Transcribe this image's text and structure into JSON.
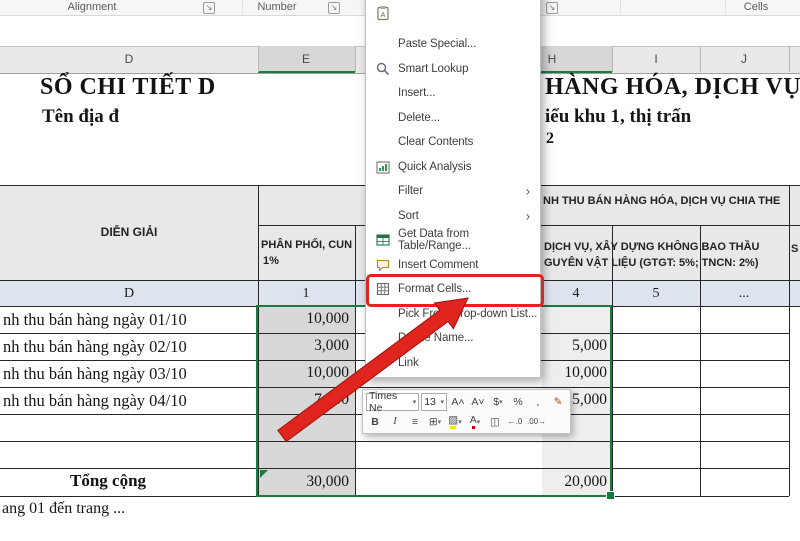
{
  "ribbon": {
    "groups": [
      "Alignment",
      "Number",
      "Cells"
    ],
    "launcher_glyph": "↘"
  },
  "columns": {
    "list": [
      "D",
      "E",
      "H",
      "I",
      "J"
    ]
  },
  "titles": {
    "line1_left": "SỔ CHI TIẾT D",
    "line1_right": "HÀNG HÓA, DỊCH VỤ",
    "line2_left": "Tên địa đ",
    "line2_right": "iểu khu 1, thị trấn",
    "fragment": "2"
  },
  "table": {
    "dien_giai": "DIỄN GIẢI",
    "span_header": "NH THU BÁN HÀNG HÓA, DỊCH VỤ CHIA THE",
    "col_e_line1": "PHÂN PHỐI, CUN",
    "col_e_line2": "1%",
    "col_h_line1": "DỊCH VỤ, XÂY DỰNG KHÔNG BAO THẦU",
    "col_h_line2": "GUYÊN VẬT LIỆU (GTGT: 5%; TNCN: 2%)",
    "right_fragment": "S",
    "number_row": [
      "D",
      "1",
      "4",
      "5",
      "..."
    ],
    "rows": [
      {
        "label": "nh thu bán hàng ngày 01/10",
        "e": "10,000",
        "h": ""
      },
      {
        "label": "nh thu bán hàng ngày 02/10",
        "e": "3,000",
        "h": "5,000"
      },
      {
        "label": "nh thu bán hàng ngày 03/10",
        "e": "10,000",
        "h": "10,000"
      },
      {
        "label": "nh thu bán hàng ngày 04/10",
        "e": "7,000",
        "h": "5,000"
      }
    ],
    "total_label": "Tổng cộng",
    "total_e": "30,000",
    "total_h": "20,000"
  },
  "footer": "ang 01 đến trang ...",
  "context_menu": {
    "submenu_glyph": "›",
    "items": [
      {
        "label": "Paste Special..."
      },
      {
        "label": "Smart Lookup"
      },
      {
        "label": "Insert..."
      },
      {
        "label": "Delete..."
      },
      {
        "label": "Clear Contents"
      },
      {
        "label": "Quick Analysis"
      },
      {
        "label": "Filter"
      },
      {
        "label": "Sort"
      },
      {
        "label": "Get Data from Table/Range..."
      },
      {
        "label": "Insert Comment"
      },
      {
        "label": "Format Cells..."
      },
      {
        "label": "Pick From Drop-down List..."
      },
      {
        "label": "Define Name..."
      },
      {
        "label": "Link"
      }
    ]
  },
  "mini_toolbar": {
    "font_name": "Times Ne",
    "font_size": "13",
    "dropdown_glyph": "▾",
    "grow_font": "A˄",
    "shrink_font": "A˅",
    "currency": "$",
    "percent": "%",
    "comma": ",",
    "bold": "B",
    "italic": "I",
    "align": "≡",
    "borders": "⊞",
    "fill": "▨",
    "font_color": "A",
    "merge": "◫",
    "inc_decimal": "←.0",
    "dec_decimal": ".00→",
    "brush": "✎"
  },
  "colors": {
    "selection_green": "#1a7b41",
    "annotation_red": "#e0241e"
  }
}
